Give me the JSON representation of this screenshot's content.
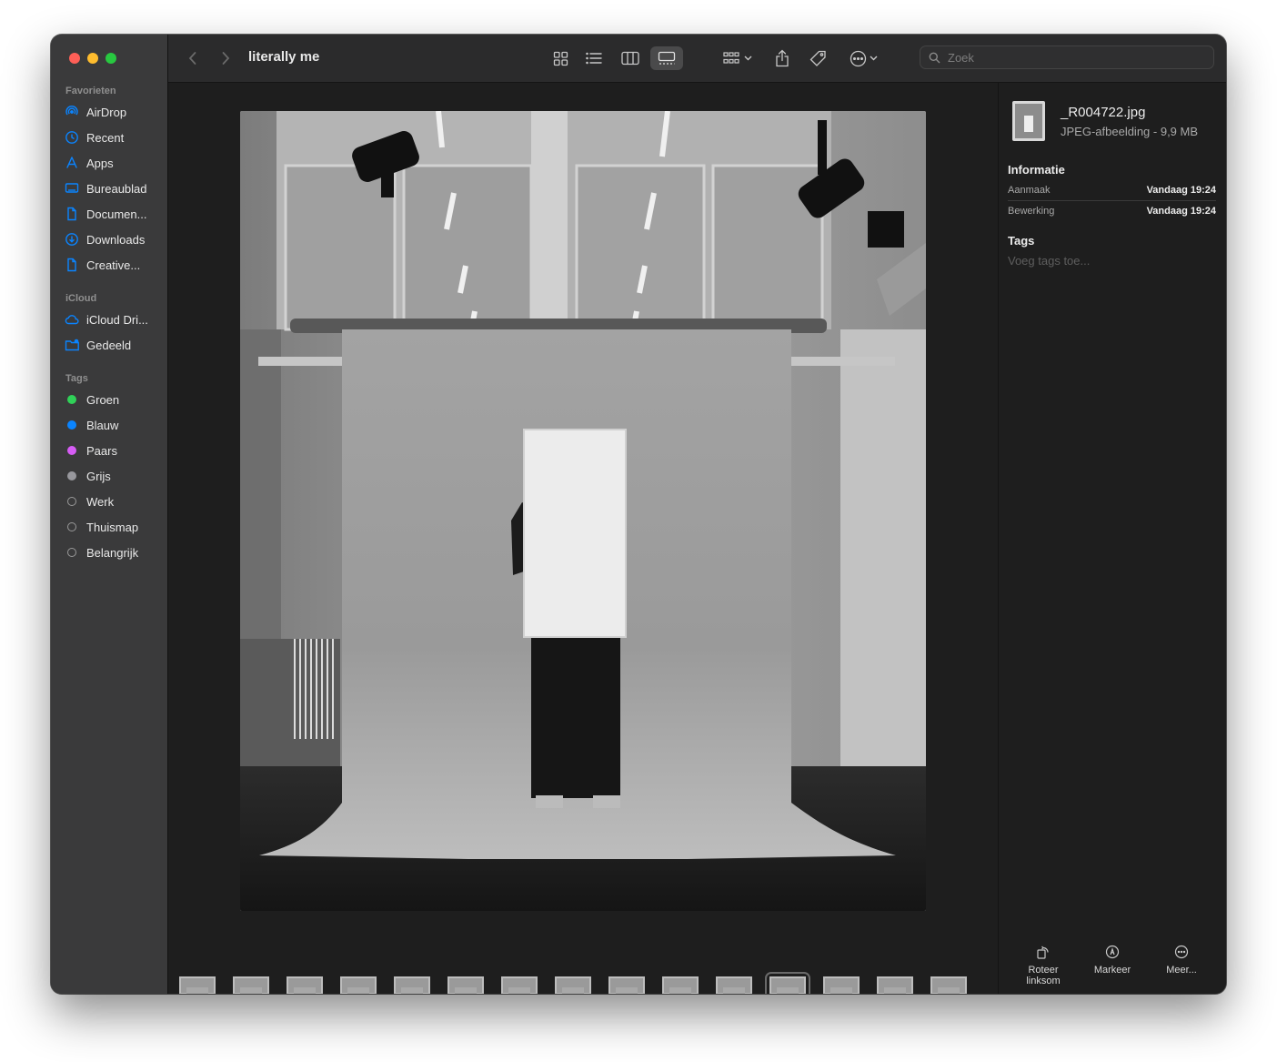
{
  "window": {
    "title": "literally me",
    "traffic_lights": [
      "#fe5f57",
      "#febc2e",
      "#28c840"
    ]
  },
  "sidebar": {
    "favorites_title": "Favorieten",
    "favorites": [
      {
        "label": "AirDrop",
        "icon": "airdrop-icon"
      },
      {
        "label": "Recent",
        "icon": "clock-icon"
      },
      {
        "label": "Apps",
        "icon": "apps-icon"
      },
      {
        "label": "Bureaublad",
        "icon": "desktop-icon"
      },
      {
        "label": "Documen...",
        "icon": "document-icon"
      },
      {
        "label": "Downloads",
        "icon": "download-icon"
      },
      {
        "label": "Creative...",
        "icon": "document-icon"
      }
    ],
    "icloud_title": "iCloud",
    "icloud": [
      {
        "label": "iCloud Dri...",
        "icon": "cloud-icon"
      },
      {
        "label": "Gedeeld",
        "icon": "shared-folder-icon"
      }
    ],
    "tags_title": "Tags",
    "tags": [
      {
        "label": "Groen",
        "color": "#30d158"
      },
      {
        "label": "Blauw",
        "color": "#0a84ff"
      },
      {
        "label": "Paars",
        "color": "#d65cf5"
      },
      {
        "label": "Grijs",
        "color": "#98989d"
      },
      {
        "label": "Werk",
        "color": ""
      },
      {
        "label": "Thuismap",
        "color": ""
      },
      {
        "label": "Belangrijk",
        "color": ""
      }
    ],
    "accent": "#0a84ff"
  },
  "toolbar": {
    "search_placeholder": "Zoek",
    "active_view": "gallery"
  },
  "inspector": {
    "file_name": "_R004722.jpg",
    "file_meta": "JPEG-afbeelding - 9,9 MB",
    "info_title": "Informatie",
    "rows": [
      {
        "key": "Aanmaak",
        "value": "Vandaag 19:24"
      },
      {
        "key": "Bewerking",
        "value": "Vandaag 19:24"
      }
    ],
    "tags_title": "Tags",
    "tags_placeholder": "Voeg tags toe...",
    "actions": [
      {
        "label": "Roteer linksom",
        "icon": "rotate-left-icon"
      },
      {
        "label": "Markeer",
        "icon": "markup-icon"
      },
      {
        "label": "Meer...",
        "icon": "more-icon"
      }
    ]
  },
  "gallery": {
    "thumbnail_count": 15,
    "selected_index": 11
  }
}
